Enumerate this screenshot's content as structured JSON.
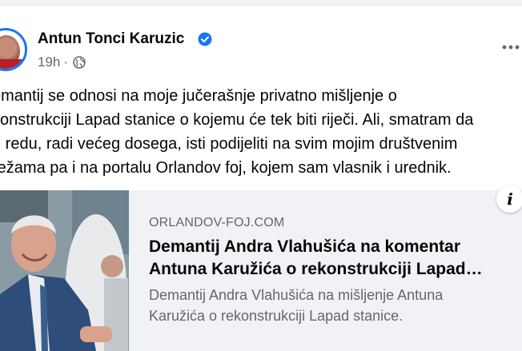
{
  "post": {
    "author_name": "Antun Tonci Karuzic",
    "verified": true,
    "time": "19h",
    "separator": "·",
    "audience_icon": "globe-icon",
    "more_icon": "more-horizontal-icon",
    "text": "emantij se odnosi na moje jučerašnje privatno mišljenje o\nkonstrukciji Lapad stanice o kojemu će tek biti riječi. Ali, smatram da\nu redu, radi većeg dosega, isti podijeliti na svim mojim društvenim\nrežama pa i na portalu Orlandov foj, kojem sam vlasnik i urednik."
  },
  "link_preview": {
    "domain": "ORLANDOV-FOJ.COM",
    "headline": "Demantij Andra Vlahušića na komentar\nAntuna Karužića o rekonstrukciji Lapad…",
    "description": "Demantij Andra Vlahušića na mišljenje Antuna\nKaružića o rekonstrukciji Lapad stanice.",
    "info_label": "i"
  },
  "colors": {
    "accent": "#1877f2",
    "secondary_text": "#65676b",
    "card_bg": "#f0f2f5"
  }
}
